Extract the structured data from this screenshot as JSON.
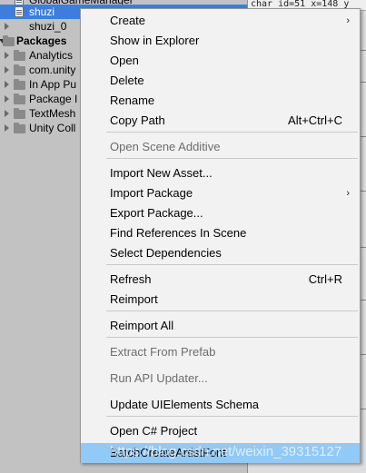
{
  "project_panel": {
    "rows": [
      {
        "label": "GlobalGameManager",
        "kind": "file"
      },
      {
        "label": "shuzi",
        "kind": "file",
        "selected": true
      },
      {
        "label": "shuzi_0",
        "kind": "sub"
      },
      {
        "label": "Packages",
        "kind": "root"
      },
      {
        "label": "Analytics",
        "kind": "folder"
      },
      {
        "label": "com.unity",
        "kind": "folder"
      },
      {
        "label": "In App Pu",
        "kind": "folder"
      },
      {
        "label": "Package I",
        "kind": "folder"
      },
      {
        "label": "TextMesh",
        "kind": "folder"
      },
      {
        "label": "Unity Coll",
        "kind": "folder"
      }
    ]
  },
  "right_panel": {
    "top_text": "char id=51   x=148   y"
  },
  "context_menu": {
    "items": [
      {
        "label": "Create",
        "shortcut": "",
        "submenu": true,
        "disabled": false
      },
      {
        "label": "Show in Explorer",
        "shortcut": "",
        "submenu": false,
        "disabled": false
      },
      {
        "label": "Open",
        "shortcut": "",
        "submenu": false,
        "disabled": false
      },
      {
        "label": "Delete",
        "shortcut": "",
        "submenu": false,
        "disabled": false
      },
      {
        "label": "Rename",
        "shortcut": "",
        "submenu": false,
        "disabled": false
      },
      {
        "label": "Copy Path",
        "shortcut": "Alt+Ctrl+C",
        "submenu": false,
        "disabled": false
      },
      {
        "label": "Open Scene Additive",
        "shortcut": "",
        "submenu": false,
        "disabled": true
      },
      {
        "label": "Import New Asset...",
        "shortcut": "",
        "submenu": false,
        "disabled": false
      },
      {
        "label": "Import Package",
        "shortcut": "",
        "submenu": true,
        "disabled": false
      },
      {
        "label": "Export Package...",
        "shortcut": "",
        "submenu": false,
        "disabled": false
      },
      {
        "label": "Find References In Scene",
        "shortcut": "",
        "submenu": false,
        "disabled": false
      },
      {
        "label": "Select Dependencies",
        "shortcut": "",
        "submenu": false,
        "disabled": false
      },
      {
        "label": "Refresh",
        "shortcut": "Ctrl+R",
        "submenu": false,
        "disabled": false
      },
      {
        "label": "Reimport",
        "shortcut": "",
        "submenu": false,
        "disabled": false
      },
      {
        "label": "Reimport All",
        "shortcut": "",
        "submenu": false,
        "disabled": false
      },
      {
        "label": "Extract From Prefab",
        "shortcut": "",
        "submenu": false,
        "disabled": true
      },
      {
        "label": "Run API Updater...",
        "shortcut": "",
        "submenu": false,
        "disabled": true
      },
      {
        "label": "Update UIElements Schema",
        "shortcut": "",
        "submenu": false,
        "disabled": false
      },
      {
        "label": "Open C# Project",
        "shortcut": "",
        "submenu": false,
        "disabled": false
      },
      {
        "label": "BatchCreateArtistFont",
        "shortcut": "",
        "submenu": false,
        "disabled": false,
        "highlighted": true
      }
    ],
    "submenu_glyph": "›"
  },
  "watermark": "https://blog.csdn.net/weixin_39315127",
  "colors": {
    "selection": "#3e7ddc",
    "menu_highlight": "#91c9f7",
    "menu_bg": "#f2f2f2",
    "panel_bg": "#c2c2c2"
  }
}
